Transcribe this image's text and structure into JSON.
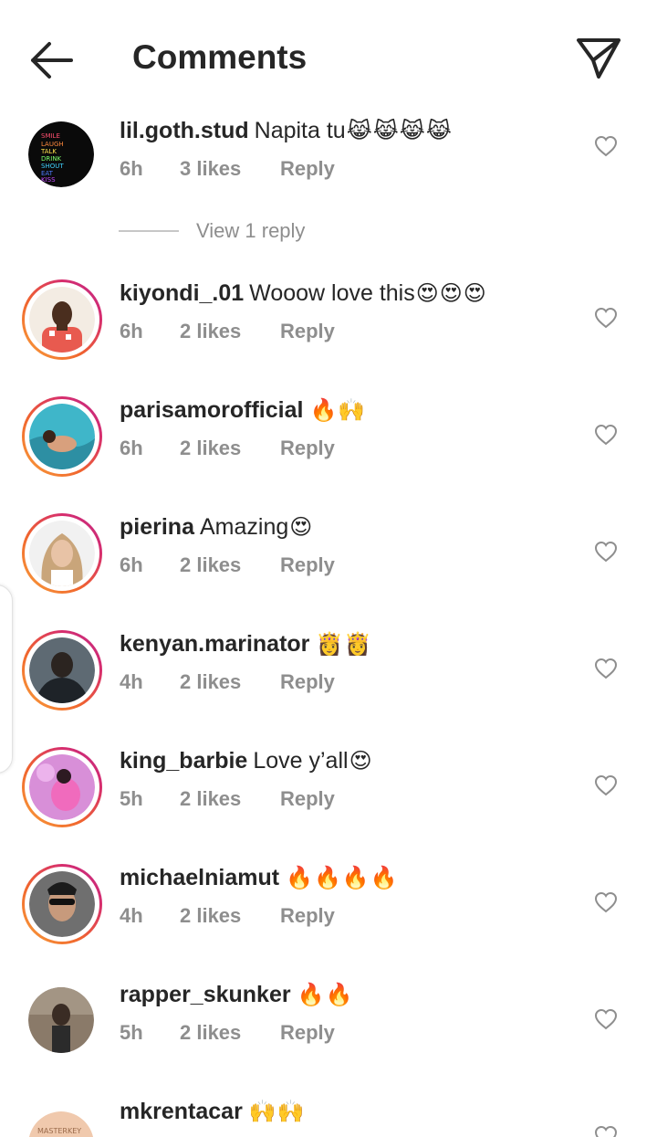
{
  "header": {
    "title": "Comments",
    "back_icon": "arrow-left-icon",
    "share_icon": "paper-plane-icon"
  },
  "colors": {
    "story_ring_start": "#f9a23a",
    "story_ring_end": "#c02b86",
    "meta_gray": "#8e8e8e",
    "text": "#262626"
  },
  "comments": [
    {
      "username": "lil.goth.stud",
      "text": "Napita tu",
      "emoji": "😹😹😹😹",
      "time": "6h",
      "likes": "3 likes",
      "reply": "Reply",
      "story_ring": false
    },
    {
      "username": "kiyondi_.01",
      "text": "Wooow love this",
      "emoji": "😍😍😍",
      "time": "6h",
      "likes": "2 likes",
      "reply": "Reply",
      "story_ring": true
    },
    {
      "username": "parisamorofficial",
      "text": "",
      "emoji": "🔥🙌",
      "time": "6h",
      "likes": "2 likes",
      "reply": "Reply",
      "story_ring": true
    },
    {
      "username": "pierina",
      "text": "Amazing",
      "emoji": "😍",
      "time": "6h",
      "likes": "2 likes",
      "reply": "Reply",
      "story_ring": true
    },
    {
      "username": "kenyan.marinator",
      "text": "",
      "emoji": "👸👸",
      "time": "4h",
      "likes": "2 likes",
      "reply": "Reply",
      "story_ring": true
    },
    {
      "username": "king_barbie",
      "text": "Love y’all",
      "emoji": "😍",
      "time": "5h",
      "likes": "2 likes",
      "reply": "Reply",
      "story_ring": true
    },
    {
      "username": "michaelniamut",
      "text": "",
      "emoji": "🔥🔥🔥🔥",
      "time": "4h",
      "likes": "2 likes",
      "reply": "Reply",
      "story_ring": true
    },
    {
      "username": "rapper_skunker",
      "text": "",
      "emoji": "🔥🔥",
      "time": "5h",
      "likes": "2 likes",
      "reply": "Reply",
      "story_ring": false
    },
    {
      "username": "mkrentacar",
      "text": "",
      "emoji": "🙌🙌",
      "time": "",
      "likes": "",
      "reply": "",
      "story_ring": false
    }
  ],
  "view_replies": {
    "label": "View 1 reply"
  },
  "avatar_neon_text": "SMILE LAUGH TALK DRINK SHOUT EAT KISS",
  "avatar_logo_text": "MASTERKEY"
}
